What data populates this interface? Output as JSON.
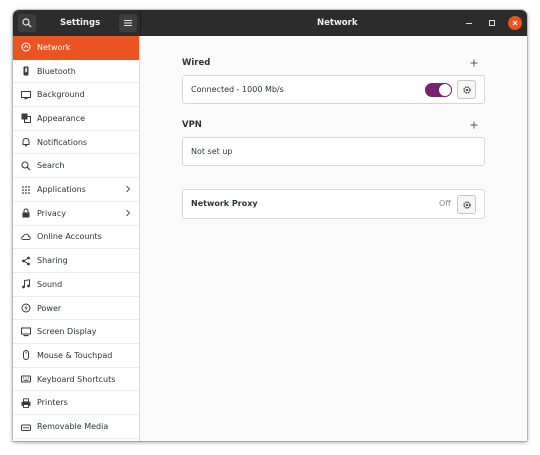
{
  "titlebar": {
    "app_title": "Settings",
    "page_title": "Network"
  },
  "sidebar": {
    "items": [
      {
        "label": "Network",
        "icon": "network-icon",
        "active": true
      },
      {
        "label": "Bluetooth",
        "icon": "bluetooth-icon"
      },
      {
        "label": "Background",
        "icon": "background-icon"
      },
      {
        "label": "Appearance",
        "icon": "appearance-icon"
      },
      {
        "label": "Notifications",
        "icon": "bell-icon"
      },
      {
        "label": "Search",
        "icon": "search-icon"
      },
      {
        "label": "Applications",
        "icon": "applications-icon",
        "chevron": true
      },
      {
        "label": "Privacy",
        "icon": "privacy-icon",
        "chevron": true
      },
      {
        "label": "Online Accounts",
        "icon": "cloud-icon"
      },
      {
        "label": "Sharing",
        "icon": "share-icon"
      },
      {
        "label": "Sound",
        "icon": "music-note-icon"
      },
      {
        "label": "Power",
        "icon": "power-icon"
      },
      {
        "label": "Screen Display",
        "icon": "display-icon"
      },
      {
        "label": "Mouse & Touchpad",
        "icon": "mouse-icon"
      },
      {
        "label": "Keyboard Shortcuts",
        "icon": "keyboard-icon"
      },
      {
        "label": "Printers",
        "icon": "printer-icon"
      },
      {
        "label": "Removable Media",
        "icon": "removable-media-icon"
      }
    ]
  },
  "wired": {
    "title": "Wired",
    "status": "Connected - 1000 Mb/s",
    "toggle_on": true
  },
  "vpn": {
    "title": "VPN",
    "status": "Not set up"
  },
  "proxy": {
    "title": "Network Proxy",
    "status": "Off"
  },
  "colors": {
    "accent": "#e95420",
    "toggle": "#77216f",
    "titlebar": "#2c2c2c"
  }
}
